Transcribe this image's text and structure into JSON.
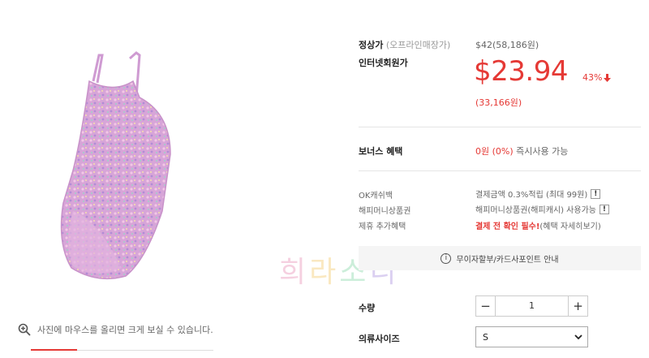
{
  "price": {
    "normal_label": "정상가",
    "normal_note": "(오프라인매장가)",
    "normal_value": "$42(58,186원)",
    "member_label": "인터넷회원가",
    "member_value": "$23.94",
    "discount": "43%",
    "member_won": "(33,166원)"
  },
  "bonus": {
    "label": "보너스 혜택",
    "value_red": "0원 (0%)",
    "value_rest": " 즉시사용 가능"
  },
  "benefits": [
    {
      "label": "OK캐쉬백",
      "value": "결제금액 0.3%적립 (최대 99원)"
    },
    {
      "label": "해피머니상품권",
      "value": "해피머니상품권(해피캐시) 사용가능"
    },
    {
      "label": "제휴 추가혜택",
      "value_red": "결제 전 확인 필수!",
      "value_rest": " (혜택 자세히보기)"
    }
  ],
  "install_bar": {
    "text": "무이자할부/카드사포인트 안내"
  },
  "quantity": {
    "label": "수량",
    "value": "1"
  },
  "size": {
    "label": "의류사이즈",
    "selected": "S"
  },
  "zoom_hint": "사진에 마우스를 올리면 크게 보실 수 있습니다.",
  "watermark": [
    "희",
    "라",
    "소",
    "니"
  ],
  "colors": {
    "accent": "#e53935",
    "swimsuit": "#d9a6d6"
  }
}
